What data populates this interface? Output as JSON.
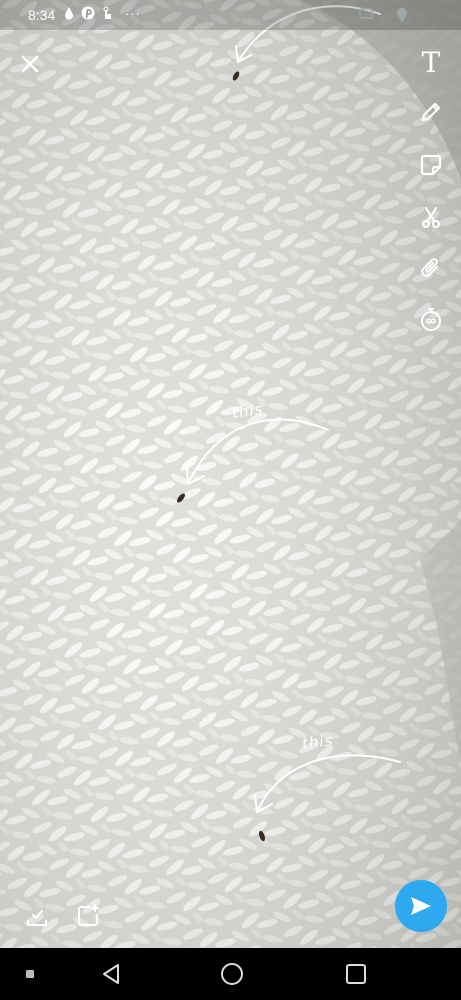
{
  "status_bar": {
    "time": "8:34",
    "dots": "···"
  },
  "annotations": {
    "caption_1": "this",
    "caption_2": "this"
  },
  "toolbar": {
    "tools": [
      "text-tool",
      "pencil-tool",
      "sticker-tool",
      "scissors-tool",
      "attach-tool",
      "timer-tool"
    ],
    "text_tool_glyph": "T"
  },
  "colors": {
    "send_accent": "#2ea8ef",
    "overlay_icons": "#ffffff"
  }
}
